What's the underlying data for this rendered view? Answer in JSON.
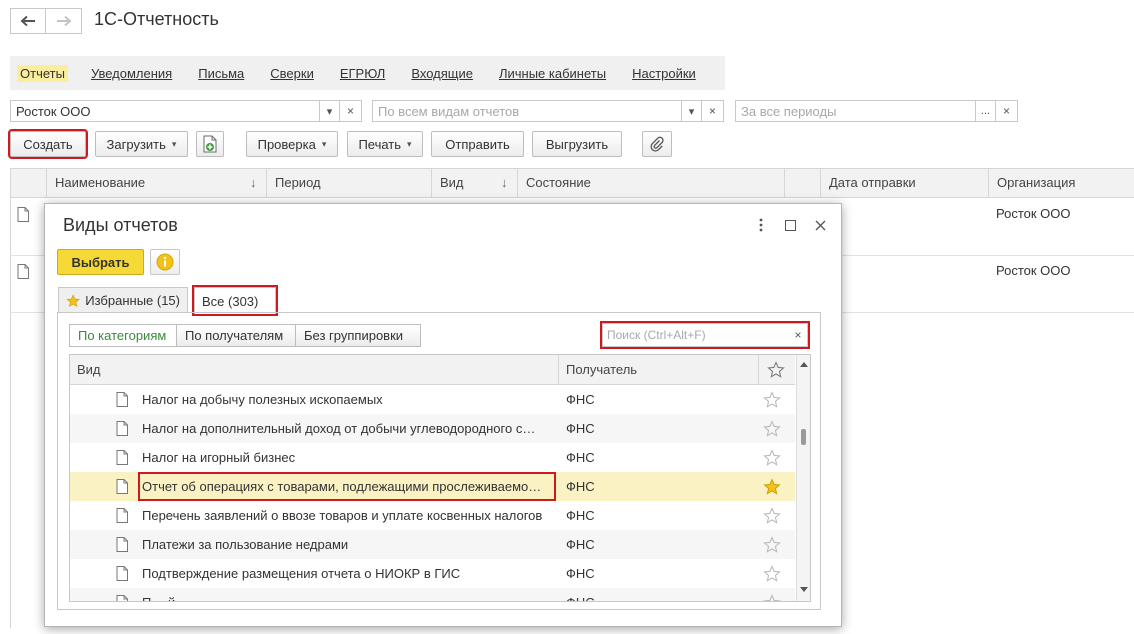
{
  "app": {
    "title": "1С-Отчетность"
  },
  "sections": [
    "Отчеты",
    "Уведомления",
    "Письма",
    "Сверки",
    "ЕГРЮЛ",
    "Входящие",
    "Личные кабинеты",
    "Настройки"
  ],
  "filters": {
    "organization": "Росток ООО",
    "report_type_placeholder": "По всем видам отчетов",
    "period_placeholder": "За все периоды",
    "dropdown_glyph": "▾",
    "clear_glyph": "×",
    "ellipsis_glyph": "..."
  },
  "toolbar": {
    "create": "Создать",
    "load": "Загрузить",
    "check": "Проверка",
    "print": "Печать",
    "send": "Отправить",
    "export": "Выгрузить",
    "dropdown_glyph": "▾"
  },
  "list": {
    "columns": [
      "Наименование",
      "Период",
      "Вид",
      "Состояние",
      "Дата отправки",
      "Организация"
    ],
    "sort_glyph": "↓",
    "rows": [
      {
        "organization": "Росток ООО"
      },
      {
        "organization": "Росток ООО"
      }
    ]
  },
  "dialog": {
    "title": "Виды отчетов",
    "select_button": "Выбрать",
    "tabs": [
      "Избранные (15)",
      "Все (303)"
    ],
    "groupings": [
      "По категориям",
      "По получателям",
      "Без группировки"
    ],
    "search_placeholder": "Поиск (Ctrl+Alt+F)",
    "search_clear": "×",
    "columns": {
      "type": "Вид",
      "recipient": "Получатель"
    },
    "items": [
      {
        "name": "Налог на добычу полезных ископаемых",
        "recipient": "ФНС",
        "favorite": false
      },
      {
        "name": "Налог на дополнительный доход от добычи углеводородного с…",
        "recipient": "ФНС",
        "favorite": false
      },
      {
        "name": "Налог на игорный бизнес",
        "recipient": "ФНС",
        "favorite": false
      },
      {
        "name": "Отчет об операциях с товарами, подлежащими прослеживаемо…",
        "recipient": "ФНС",
        "favorite": true
      },
      {
        "name": "Перечень заявлений о ввозе товаров и уплате косвенных налогов",
        "recipient": "ФНС",
        "favorite": false
      },
      {
        "name": "Платежи за пользование недрами",
        "recipient": "ФНС",
        "favorite": false
      },
      {
        "name": "Подтверждение размещения отчета о НИОКР в ГИС",
        "recipient": "ФНС",
        "favorite": false
      },
      {
        "name": "П…                              й",
        "recipient": "ФНС",
        "favorite": false
      }
    ],
    "selected_index": 3
  },
  "colors": {
    "highlight_red": "#d0191f",
    "select_yellow": "#f7d935",
    "active_section": "#fbed9e",
    "selected_row": "#fbf2c4",
    "star_gold": "#f2c21b"
  }
}
